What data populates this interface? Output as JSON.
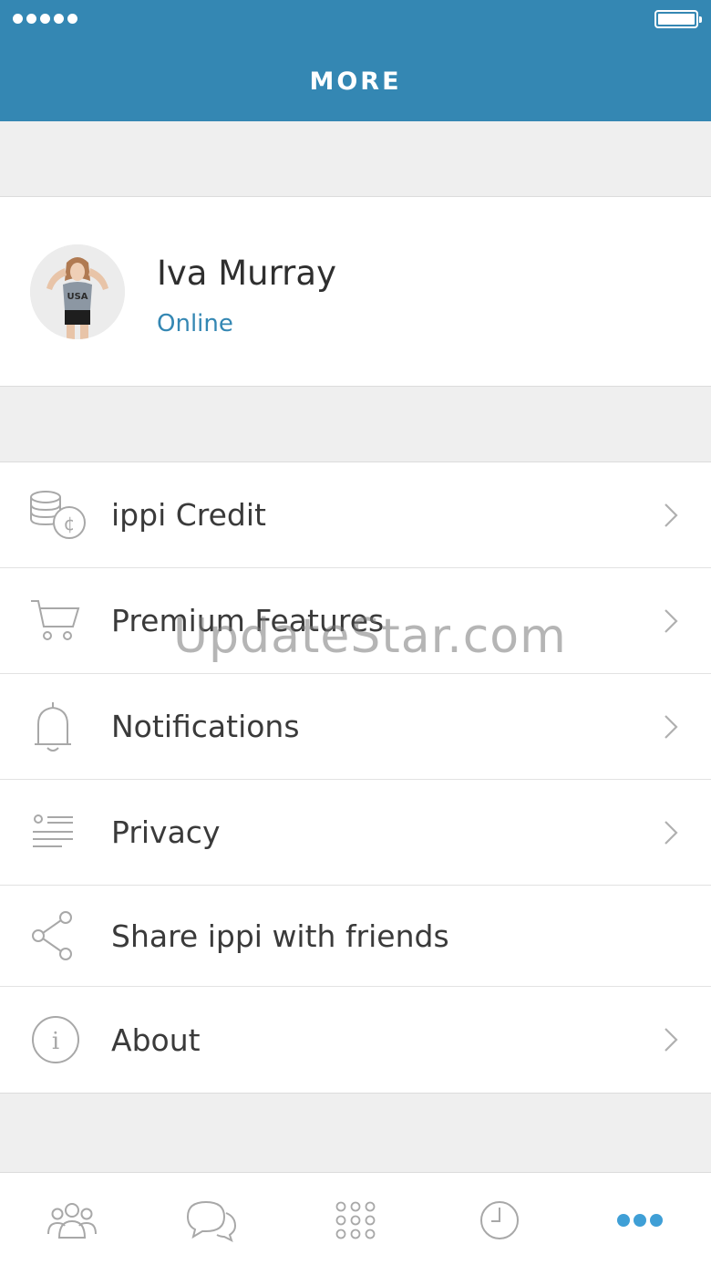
{
  "header": {
    "title": "MORE"
  },
  "profile": {
    "name": "Iva Murray",
    "status": "Online"
  },
  "menu": [
    {
      "label": "ippi Credit",
      "icon": "coins-icon",
      "chevron": true
    },
    {
      "label": "Premium Features",
      "icon": "cart-icon",
      "chevron": true
    },
    {
      "label": "Notifications",
      "icon": "bell-icon",
      "chevron": true
    },
    {
      "label": "Privacy",
      "icon": "privacy-list-icon",
      "chevron": true
    },
    {
      "label": "Share ippi with friends",
      "icon": "share-icon",
      "chevron": false
    },
    {
      "label": "About",
      "icon": "info-icon",
      "chevron": true
    }
  ],
  "watermark": "UpdateStar.com",
  "tabs": [
    {
      "name": "contacts",
      "icon": "contacts-icon",
      "active": false
    },
    {
      "name": "chat",
      "icon": "chat-icon",
      "active": false
    },
    {
      "name": "keypad",
      "icon": "keypad-icon",
      "active": false
    },
    {
      "name": "history",
      "icon": "clock-icon",
      "active": false
    },
    {
      "name": "more",
      "icon": "more-dots-icon",
      "active": true
    }
  ],
  "colors": {
    "accent": "#3487b3",
    "background": "#efefef",
    "icon": "#a8a8a8"
  }
}
